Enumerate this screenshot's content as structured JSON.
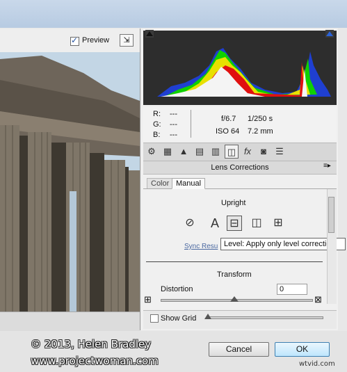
{
  "preview": {
    "label": "Preview",
    "checked": true
  },
  "readout": {
    "r_label": "R:",
    "r_value": "---",
    "g_label": "G:",
    "g_value": "---",
    "b_label": "B:",
    "b_value": "---",
    "aperture": "f/6.7",
    "shutter": "1/250 s",
    "iso": "ISO 64",
    "focal": "7.2 mm"
  },
  "tool_icons": [
    "basic-icon",
    "tone-curve-icon",
    "detail-icon",
    "hsl-icon",
    "split-toning-icon",
    "lens-corrections-icon",
    "fx-icon",
    "camera-calibration-icon",
    "presets-icon"
  ],
  "panel": {
    "title": "Lens Corrections",
    "tabs": [
      {
        "label": "Color",
        "active": false
      },
      {
        "label": "Manual",
        "active": true
      }
    ]
  },
  "upright": {
    "title": "Upright",
    "buttons": [
      {
        "name": "off",
        "glyph": "⊘"
      },
      {
        "name": "auto",
        "glyph": "A"
      },
      {
        "name": "level",
        "glyph": "⊟"
      },
      {
        "name": "vertical",
        "glyph": "◫"
      },
      {
        "name": "full",
        "glyph": "⊞"
      }
    ],
    "sync_label": "Sync Resu",
    "tooltip": "Level: Apply only level correction"
  },
  "transform": {
    "title": "Transform",
    "distortion_label": "Distortion",
    "distortion_value": "0"
  },
  "grid": {
    "label": "Show Grid",
    "checked": false
  },
  "buttons": {
    "cancel": "Cancel",
    "ok": "OK"
  },
  "watermark": {
    "copyright": "© 2013, Helen Bradley",
    "url": "www.projectwoman.com",
    "site": "wtvid.com"
  },
  "colors": {
    "accent": "#3c7fb1",
    "histogram_bg": "#2d2d2d",
    "link": "#4a68a0"
  }
}
